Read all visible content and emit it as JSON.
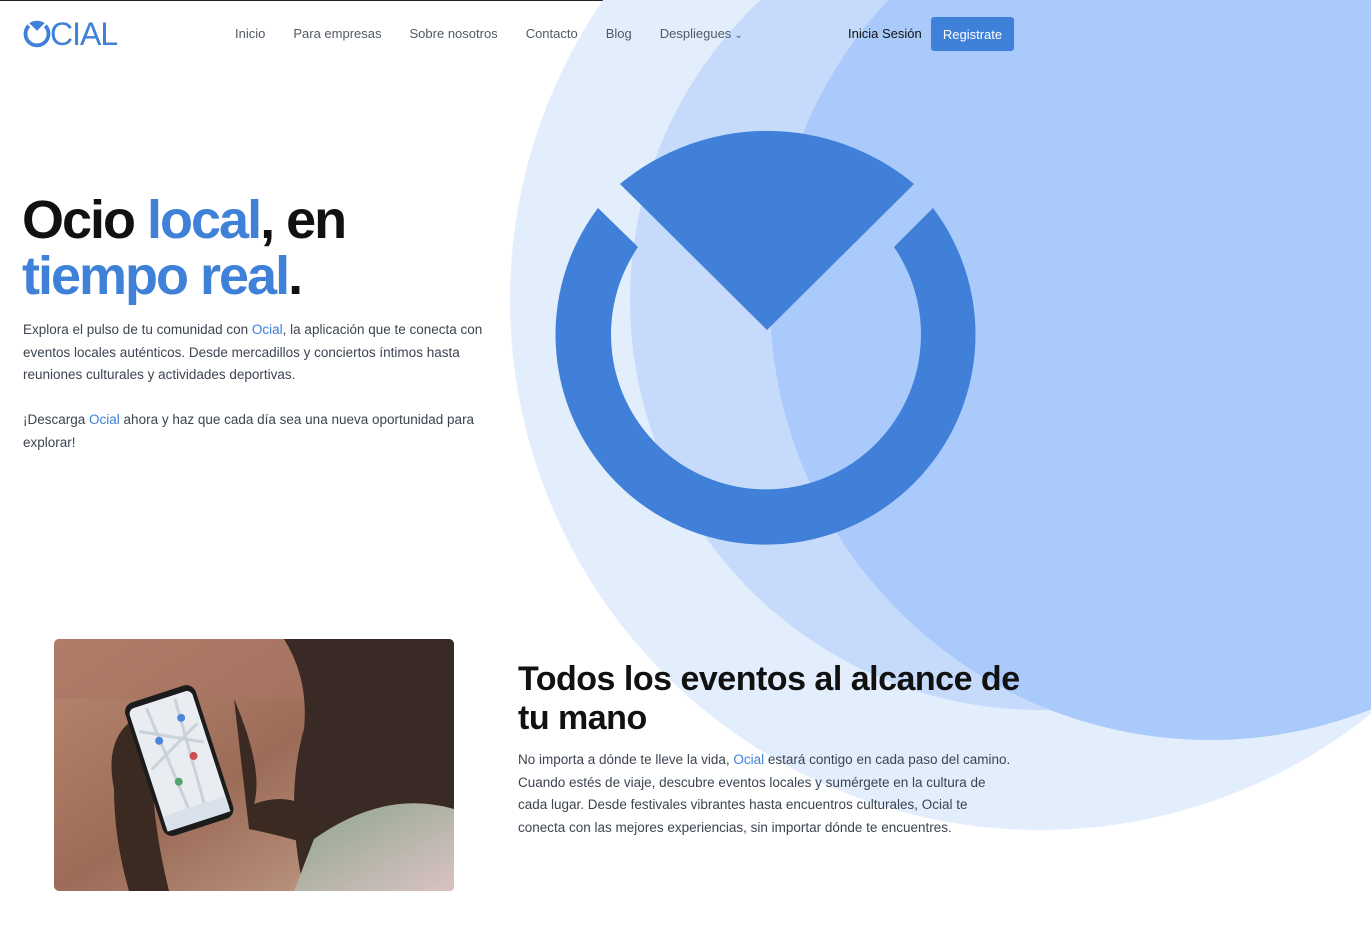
{
  "brand": {
    "logo_text": "CIAL",
    "accent": "#3f80d8"
  },
  "nav": {
    "items": [
      {
        "label": "Inicio"
      },
      {
        "label": "Para empresas"
      },
      {
        "label": "Sobre nosotros"
      },
      {
        "label": "Contacto"
      },
      {
        "label": "Blog"
      },
      {
        "label": "Despliegues",
        "dropdown_icon": "chevron-down-icon"
      }
    ],
    "login_label": "Inicia Sesión",
    "register_label": "Registrate"
  },
  "hero": {
    "title_part1": "Ocio ",
    "title_highlight1": "local",
    "title_part2": ", en",
    "title_highlight2": "tiempo real",
    "title_part3": ".",
    "para1_before": "Explora el pulso de tu comunidad con ",
    "para1_brand": "Ocial",
    "para1_after": ", la aplicación que te conecta con eventos locales auténticos. Desde mercadillos y conciertos íntimos hasta reuniones culturales y actividades deportivas.",
    "para2_before": "¡Descarga ",
    "para2_brand": "Ocial",
    "para2_after": " ahora y haz que cada día sea una nueva oportunidad para explorar!"
  },
  "section": {
    "title": "Todos los eventos al alcance de tu mano",
    "text_before": "No importa a dónde te lleve la vida, ",
    "text_brand": "Ocial",
    "text_after": " estará contigo en cada paso del camino. Cuando estés de viaje, descubre eventos locales y sumérgete en la cultura de cada lugar. Desde festivales vibrantes hasta encuentros culturales, Ocial te conecta con las mejores experiencias, sin importar dónde te encuentres."
  },
  "colors": {
    "circle_outer": "#e3eefd",
    "circle_mid": "#c6dbfb",
    "circle_inner": "#a9cafa",
    "logo_blue": "#4080d8"
  }
}
